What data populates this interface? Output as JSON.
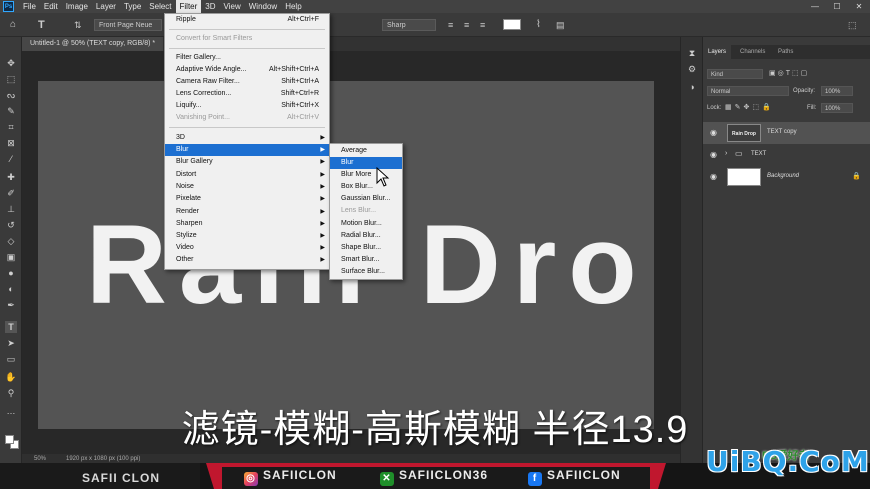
{
  "menubar": {
    "items": [
      "File",
      "Edit",
      "Image",
      "Layer",
      "Type",
      "Select",
      "Filter",
      "3D",
      "View",
      "Window",
      "Help"
    ],
    "active": "Filter",
    "ps_logo": "Ps",
    "window_controls": [
      "—",
      "☐",
      "✕"
    ]
  },
  "options_bar": {
    "font_field": "Front Page Neue",
    "antialias": "Sharp"
  },
  "document": {
    "tab_title": "Untitled-1 @ 50% (TEXT copy, RGB/8) *",
    "canvas_text": "Rain Drop",
    "zoom": "50%",
    "doc_info": "1920 px x 1080 px (100 ppi)"
  },
  "filter_menu": {
    "items": [
      {
        "label": "Ripple",
        "shortcut": "Alt+Ctrl+F"
      },
      {
        "label": "Convert for Smart Filters",
        "disabled": true
      },
      {
        "label": "Filter Gallery..."
      },
      {
        "label": "Adaptive Wide Angle...",
        "shortcut": "Alt+Shift+Ctrl+A"
      },
      {
        "label": "Camera Raw Filter...",
        "shortcut": "Shift+Ctrl+A"
      },
      {
        "label": "Lens Correction...",
        "shortcut": "Shift+Ctrl+R"
      },
      {
        "label": "Liquify...",
        "shortcut": "Shift+Ctrl+X"
      },
      {
        "label": "Vanishing Point...",
        "shortcut": "Alt+Ctrl+V",
        "disabled": true
      },
      {
        "label": "3D"
      },
      {
        "label": "Blur"
      },
      {
        "label": "Blur Gallery"
      },
      {
        "label": "Distort"
      },
      {
        "label": "Noise"
      },
      {
        "label": "Pixelate"
      },
      {
        "label": "Render"
      },
      {
        "label": "Sharpen"
      },
      {
        "label": "Stylize"
      },
      {
        "label": "Video"
      },
      {
        "label": "Other"
      }
    ]
  },
  "blur_menu": {
    "items": [
      "Average",
      "Blur",
      "Blur More",
      "Box Blur...",
      "Gaussian Blur...",
      "Lens Blur...",
      "Motion Blur...",
      "Radial Blur...",
      "Shape Blur...",
      "Smart Blur...",
      "Surface Blur..."
    ]
  },
  "layers_panel": {
    "tabs": [
      "Layers",
      "Channels",
      "Paths"
    ],
    "filter_kind": "Kind",
    "blend_mode": "Normal",
    "opacity_label": "Opacity:",
    "opacity_value": "100%",
    "lock_label": "Lock:",
    "fill_label": "Fill:",
    "fill_value": "100%",
    "layers": [
      {
        "name": "TEXT copy",
        "thumb": "Rain Drop"
      },
      {
        "name": "TEXT"
      },
      {
        "name": "Background"
      }
    ]
  },
  "caption": "滤镜-模糊-高斯模糊 半径13.9",
  "banner": {
    "name": "SAFII CLON",
    "instagram": "SAFIICLON",
    "xbox": "SAFIICLON36",
    "facebook": "SAFIICLON",
    "instagram_icon": "instagram-icon",
    "xbox_icon": "xbox-icon",
    "facebook_icon": "facebook-icon"
  },
  "watermark": {
    "text": "UiBQ.CoM",
    "sub": "PS爱好者"
  },
  "colors": {
    "menu_highlight": "#1c6fd1",
    "banner_red": "#c0172e",
    "watermark_blue": "#2ea2e8"
  }
}
